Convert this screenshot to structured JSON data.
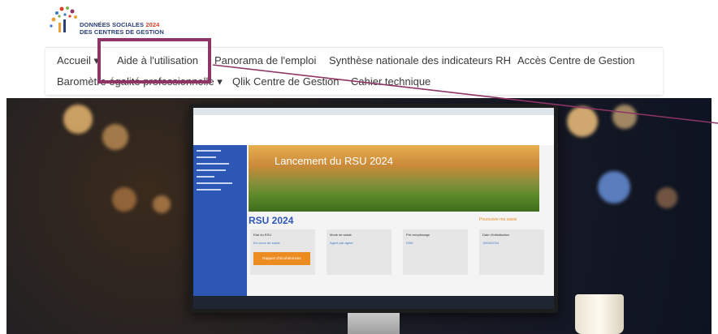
{
  "logo": {
    "line1": "DONNÉES SOCIALES",
    "year": "2024",
    "line2": "DES CENTRES DE GESTION"
  },
  "nav": {
    "row1": [
      "Accueil ▾",
      "Aide à l'utilisation",
      "Panorama de l'emploi",
      "Synthèse nationale des indicateurs RH",
      "Accès Centre de Gestion"
    ],
    "row2": [
      "Baromètre égalité professionnelle ▾",
      "Qlik Centre de Gestion",
      "Cahier technique"
    ]
  },
  "screen": {
    "banner_title": "Lancement du RSU 2024",
    "rsu_title": "RSU 2024",
    "rsu_link": "Poursuivre ma saisie",
    "cards": [
      {
        "label": "Etat du RSU",
        "value": "En cours de saisie"
      },
      {
        "label": "Mode de saisie",
        "value": "Agent par agent"
      },
      {
        "label": "Pré-remplissage",
        "value": "DSN"
      },
      {
        "label": "Date d'initialisation",
        "value": "15/04/2024"
      }
    ],
    "report_button": "Rapport d'incohérences"
  },
  "colors": {
    "accent": "#8e3466",
    "brand_blue": "#2b3f7a",
    "sidebar_blue": "#2d57b5",
    "orange": "#ec8b1f"
  }
}
